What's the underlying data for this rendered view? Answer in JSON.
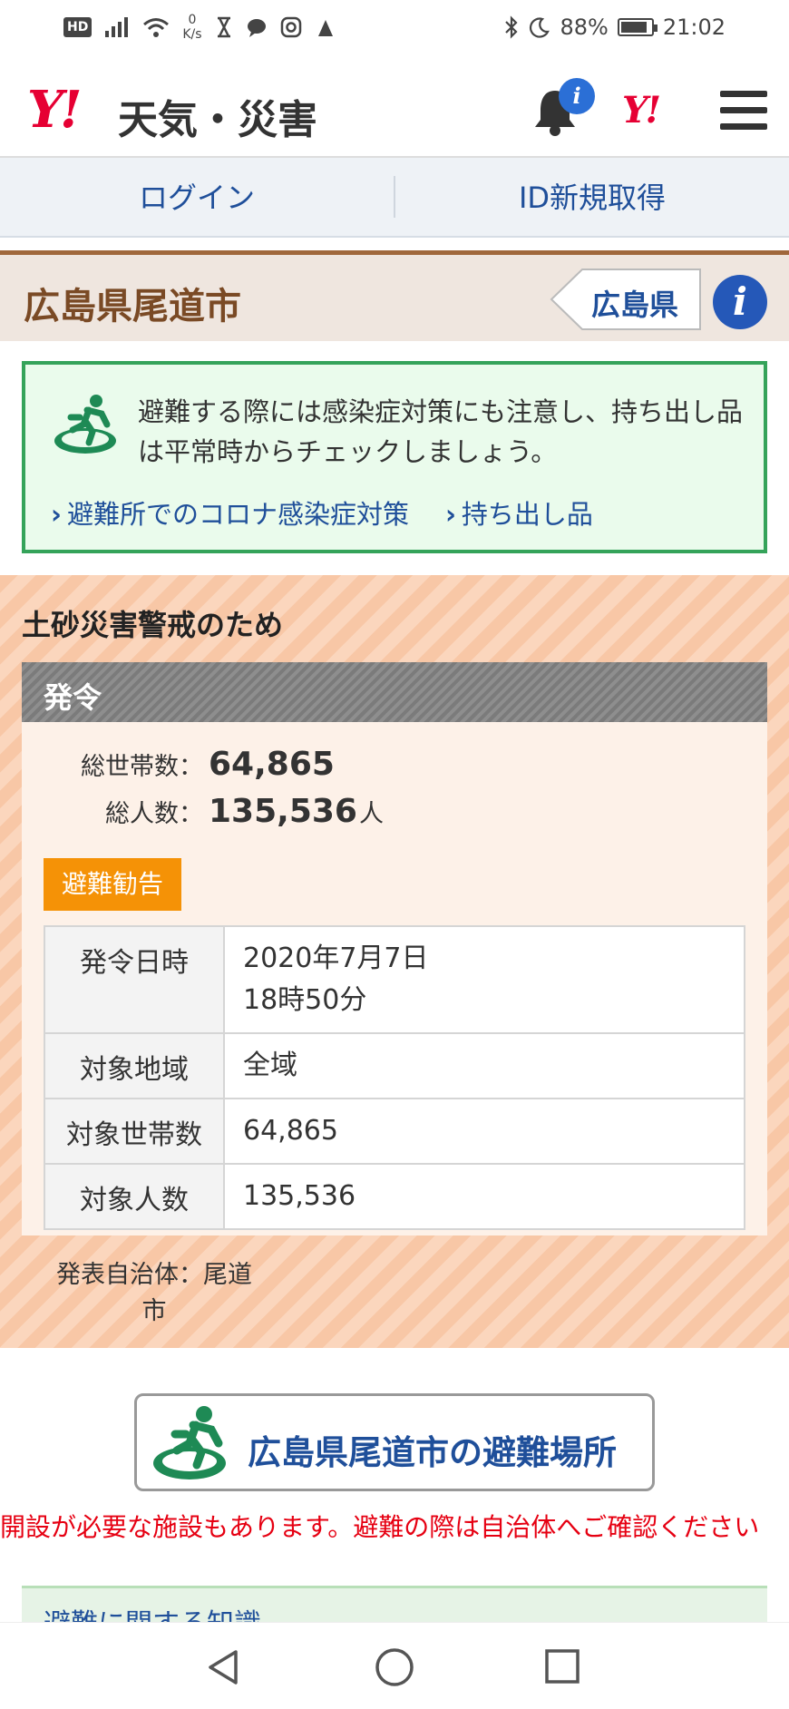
{
  "status_bar": {
    "hd": "HD",
    "speed_value": "0",
    "speed_unit": "K/s",
    "battery": "88%",
    "battery_level": 0.88,
    "time": "21:02"
  },
  "header": {
    "logo_mark": "Y!",
    "logo_text": "天気・災害",
    "notification_badge": "i",
    "yahoo_mark": "Y!"
  },
  "login_bar": {
    "login": "ログイン",
    "register": "ID新規取得"
  },
  "region": {
    "title": "広島県尾道市",
    "prefecture": "広島県",
    "info": "i"
  },
  "notice": {
    "message": "避難する際には感染症対策にも注意し、持ち出し品は平常時からチェックしましょう。",
    "links": [
      "避難所でのコロナ感染症対策",
      "持ち出し品"
    ],
    "chevron": "›"
  },
  "alert": {
    "reason": "土砂災害警戒のため",
    "status": "発令",
    "households_label": "総世帯数：",
    "households_value": "64,865",
    "people_label": "総人数：",
    "people_value": "135,536",
    "people_unit": "人",
    "level_badge": "避難勧告",
    "detail": [
      {
        "key": "発令日時",
        "value_line1": "2020年7月7日",
        "value_line2": "18時50分"
      },
      {
        "key": "対象地域",
        "value_line1": "全域"
      },
      {
        "key": "対象世帯数",
        "value_line1": "64,865"
      },
      {
        "key": "対象人数",
        "value_line1": "135,536"
      }
    ],
    "publisher_label": "発表自治体：",
    "publisher_value": "尾道市"
  },
  "shelter": {
    "button_label": "広島県尾道市の避難場所",
    "warning": "開設が必要な施設もあります。避難の際は自治体へご確認ください"
  },
  "knowledge": {
    "heading": "避難に関する知識"
  },
  "colors": {
    "accent_red": "#e60033",
    "link_blue": "#1f4f9a",
    "region_brown": "#7a4a25",
    "alert_orange": "#f59206",
    "notice_green": "#35a35a"
  }
}
